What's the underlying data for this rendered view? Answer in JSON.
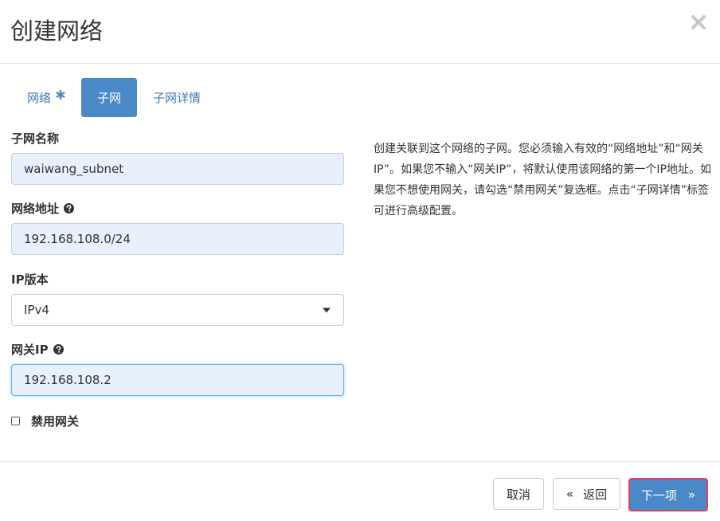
{
  "modal": {
    "title": "创建网络"
  },
  "tabs": [
    {
      "label": "网络",
      "required": true
    },
    {
      "label": "子网",
      "active": true
    },
    {
      "label": "子网详情"
    }
  ],
  "form": {
    "subnet_name": {
      "label": "子网名称",
      "value": "waiwang_subnet"
    },
    "network_address": {
      "label": "网络地址",
      "value": "192.168.108.0/24"
    },
    "ip_version": {
      "label": "IP版本",
      "selected": "IPv4"
    },
    "gateway_ip": {
      "label": "网关IP",
      "value": "192.168.108.2"
    },
    "disable_gateway": {
      "label": "禁用网关",
      "checked": false
    }
  },
  "help_text": "创建关联到这个网络的子网。您必须输入有效的“网络地址”和“网关IP”。如果您不输入“网关IP”，将默认使用该网络的第一个IP地址。如果您不想使用网关，请勾选“禁用网关”复选框。点击“子网详情”标签可进行高级配置。",
  "footer": {
    "cancel_label": "取消",
    "back_label": "返回",
    "back_chevron": "«",
    "next_label": "下一项",
    "next_chevron": "»"
  },
  "colors": {
    "primary": "#4a89c8",
    "link": "#3f77b9",
    "input_bg": "#e8f0fe",
    "highlight_border": "#e0405e"
  }
}
